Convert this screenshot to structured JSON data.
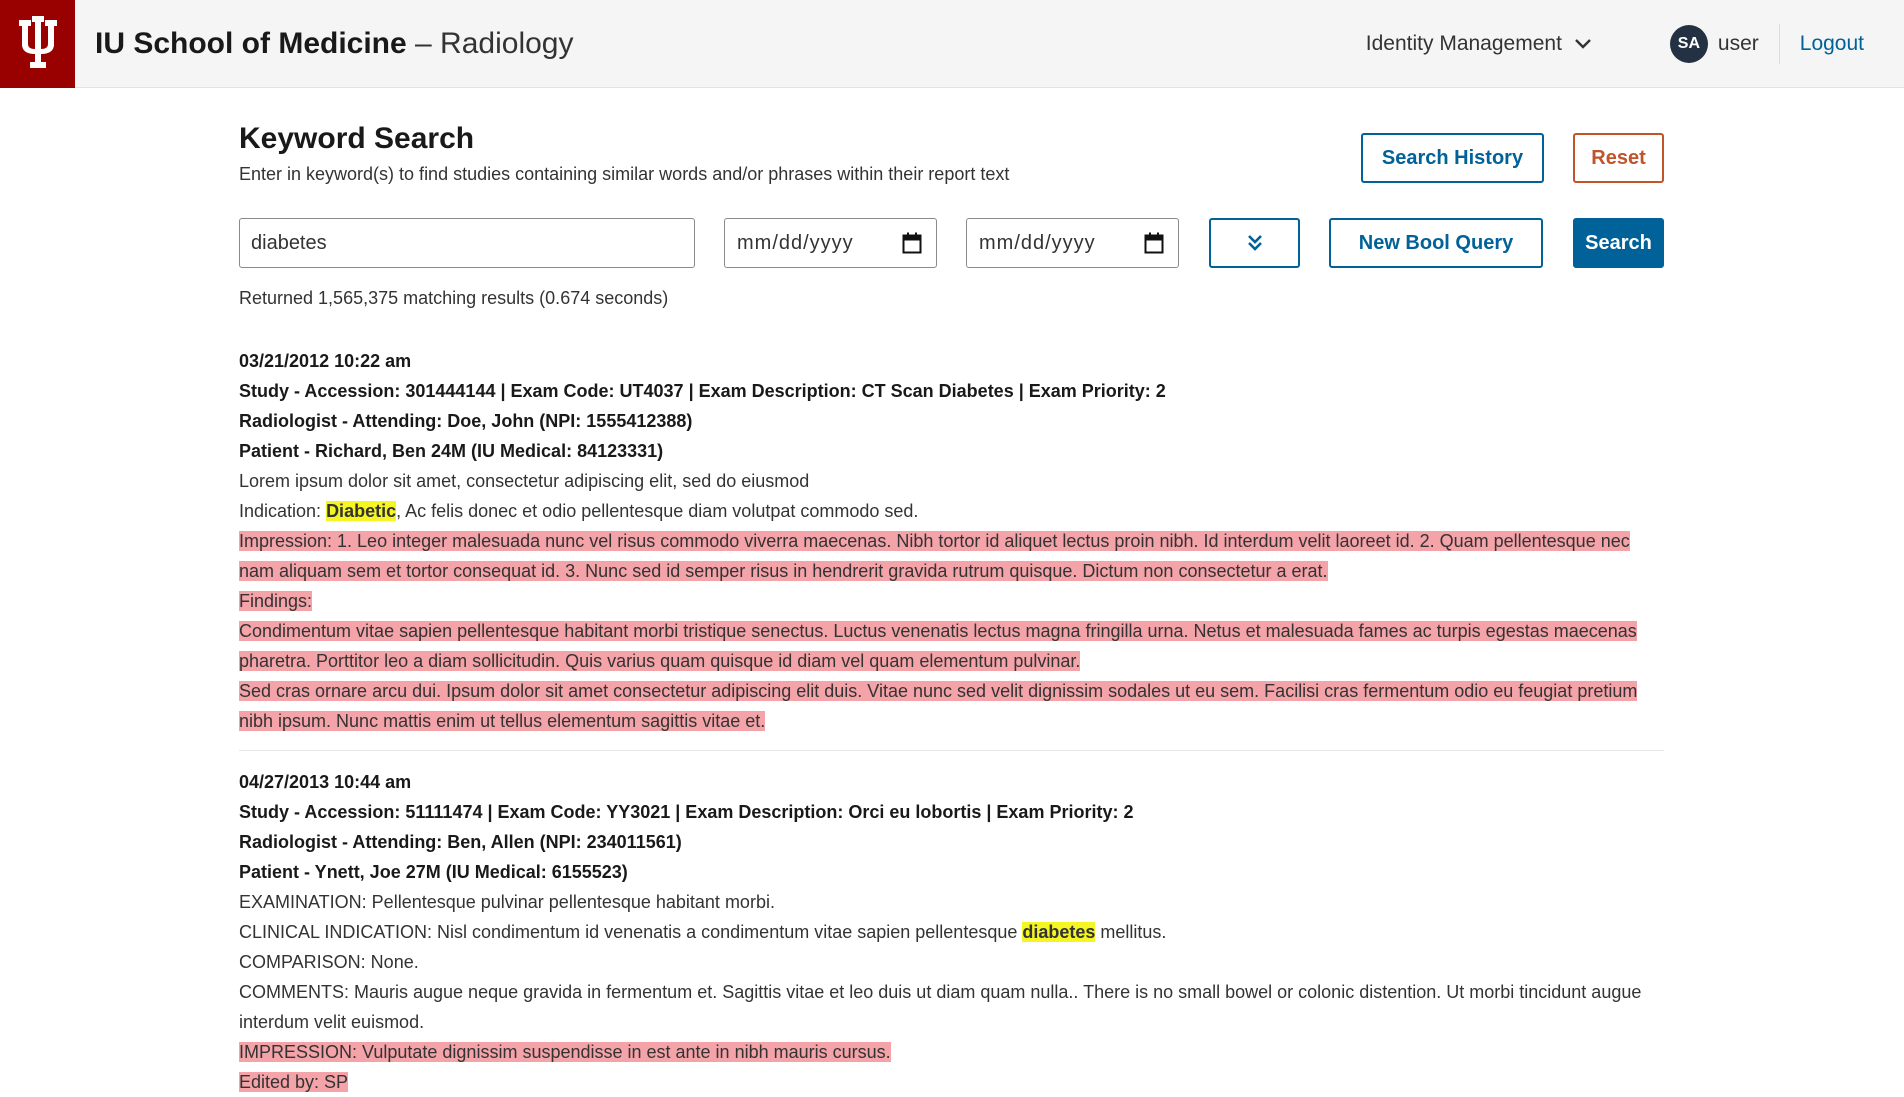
{
  "header": {
    "app_title_bold": "IU School of Medicine",
    "app_title_rest": " – Radiology",
    "identity_menu": "Identity Management",
    "avatar_initials": "SA",
    "username": "user",
    "logout": "Logout"
  },
  "search": {
    "title": "Keyword Search",
    "description": "Enter in keyword(s) to find studies containing similar words and/or phrases within their report text",
    "keyword_value": "diabetes",
    "date_from_placeholder": "mm/dd/yyyy",
    "date_to_placeholder": "mm/dd/yyyy",
    "history_button": "Search History",
    "reset_button": "Reset",
    "bool_button": "New Bool Query",
    "search_button": "Search",
    "result_count": "Returned 1,565,375 matching results (0.674 seconds)"
  },
  "results": [
    {
      "datetime": "03/21/2012 10:22 am",
      "study": "Study - Accession: 301444144 | Exam Code: UT4037 | Exam Description: CT Scan Diabetes | Exam Priority: 2",
      "radiologist": "Radiologist - Attending: Doe, John (NPI: 1555412388)",
      "patient": "Patient - Richard, Ben 24M (IU Medical: 84123331)",
      "line1": "Lorem ipsum dolor sit amet, consectetur adipiscing elit, sed do eiusmod",
      "indication_prefix": "Indication: ",
      "indication_keyword": "Diabetic",
      "indication_suffix": ", Ac felis donec et odio pellentesque diam volutpat commodo sed.",
      "impression": "Impression: 1. Leo integer malesuada nunc vel risus commodo viverra maecenas. Nibh tortor id aliquet lectus proin nibh. Id interdum velit laoreet id. 2. Quam pellentesque nec nam aliquam sem et tortor consequat id. 3. Nunc sed id semper risus in hendrerit gravida rutrum quisque. Dictum non consectetur a erat.",
      "findings_label": "Findings:",
      "findings1": "Condimentum vitae sapien pellentesque habitant morbi tristique senectus. Luctus venenatis lectus magna fringilla urna. Netus et malesuada fames ac turpis egestas maecenas pharetra. Porttitor leo a diam sollicitudin. Quis varius quam quisque id diam vel quam elementum pulvinar.",
      "findings2": "Sed cras ornare arcu dui. Ipsum dolor sit amet consectetur adipiscing elit duis. Vitae nunc sed velit dignissim sodales ut eu sem. Facilisi cras fermentum odio eu feugiat pretium nibh ipsum. Nunc mattis enim ut tellus elementum sagittis vitae et."
    },
    {
      "datetime": "04/27/2013 10:44 am",
      "study": "Study - Accession: 51111474 | Exam Code: YY3021 | Exam Description: Orci eu lobortis | Exam Priority: 2",
      "radiologist": "Radiologist - Attending: Ben, Allen (NPI: 234011561)",
      "patient": "Patient - Ynett, Joe 27M (IU Medical: 6155523)",
      "examination": "EXAMINATION: Pellentesque pulvinar pellentesque habitant morbi.",
      "clinical_prefix": "CLINICAL INDICATION: Nisl condimentum id venenatis a condimentum vitae sapien pellentesque ",
      "clinical_keyword": "diabetes",
      "clinical_suffix": " mellitus.",
      "comparison": "COMPARISON: None.",
      "comments": "COMMENTS: Mauris augue neque gravida in fermentum et. Sagittis vitae et leo duis ut diam quam nulla.. There is no small bowel or colonic distention. Ut morbi tincidunt augue interdum velit euismod.",
      "impression": "IMPRESSION: Vulputate dignissim suspendisse in est ante in nibh mauris cursus.",
      "edited": "Edited by: SP"
    }
  ],
  "colors": {
    "brand": "#990000",
    "accent": "#006298",
    "reset": "#c0542a",
    "report_highlight": "#f4a3a8",
    "keyword_highlight": "#f5f524"
  },
  "icons": [
    "iu-trident-logo",
    "chevron-down-icon",
    "calendar-icon",
    "double-chevron-down-icon"
  ]
}
